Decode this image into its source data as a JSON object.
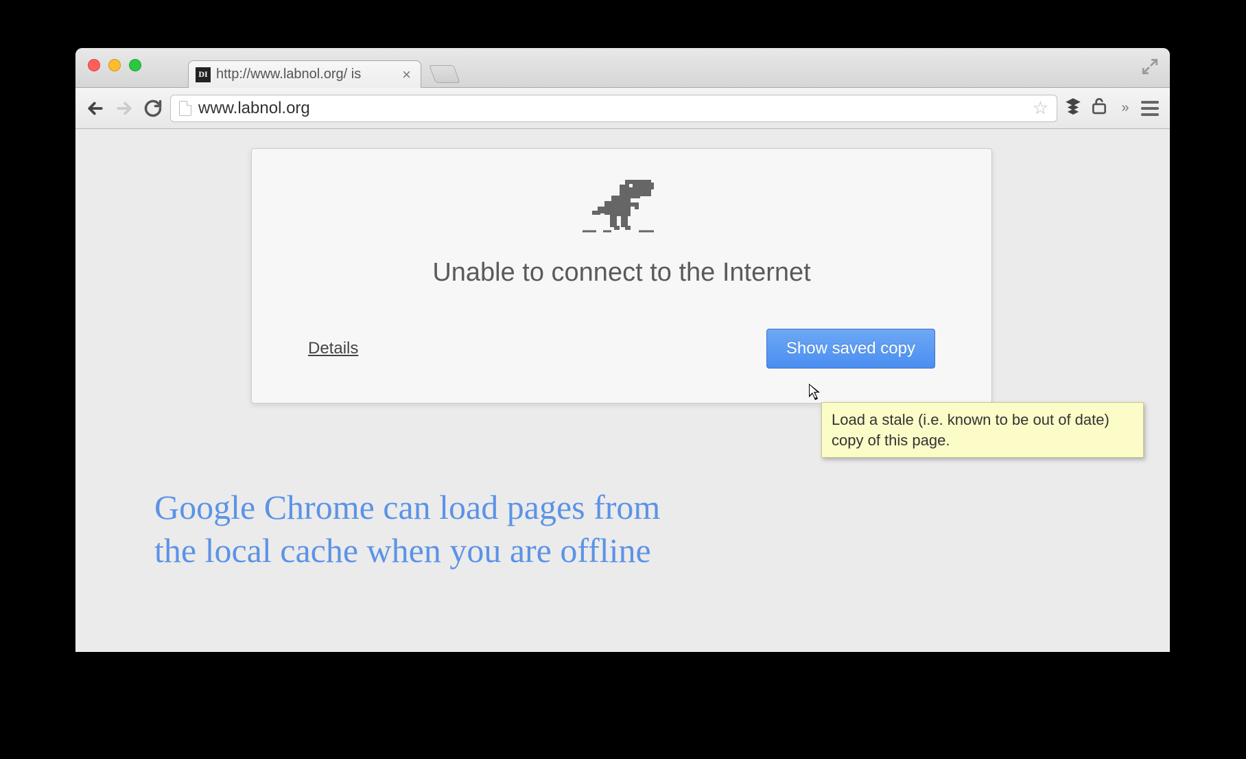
{
  "tab": {
    "favicon_text": "DI",
    "title": "http://www.labnol.org/ is"
  },
  "toolbar": {
    "url": "www.labnol.org"
  },
  "error": {
    "title": "Unable to connect to the Internet",
    "details_label": "Details",
    "button_label": "Show saved copy"
  },
  "tooltip": {
    "text": "Load a stale (i.e. known to be out of date) copy of this page."
  },
  "annotation": {
    "line1": "Google Chrome can load pages from",
    "line2": "the local cache when you are offline"
  }
}
